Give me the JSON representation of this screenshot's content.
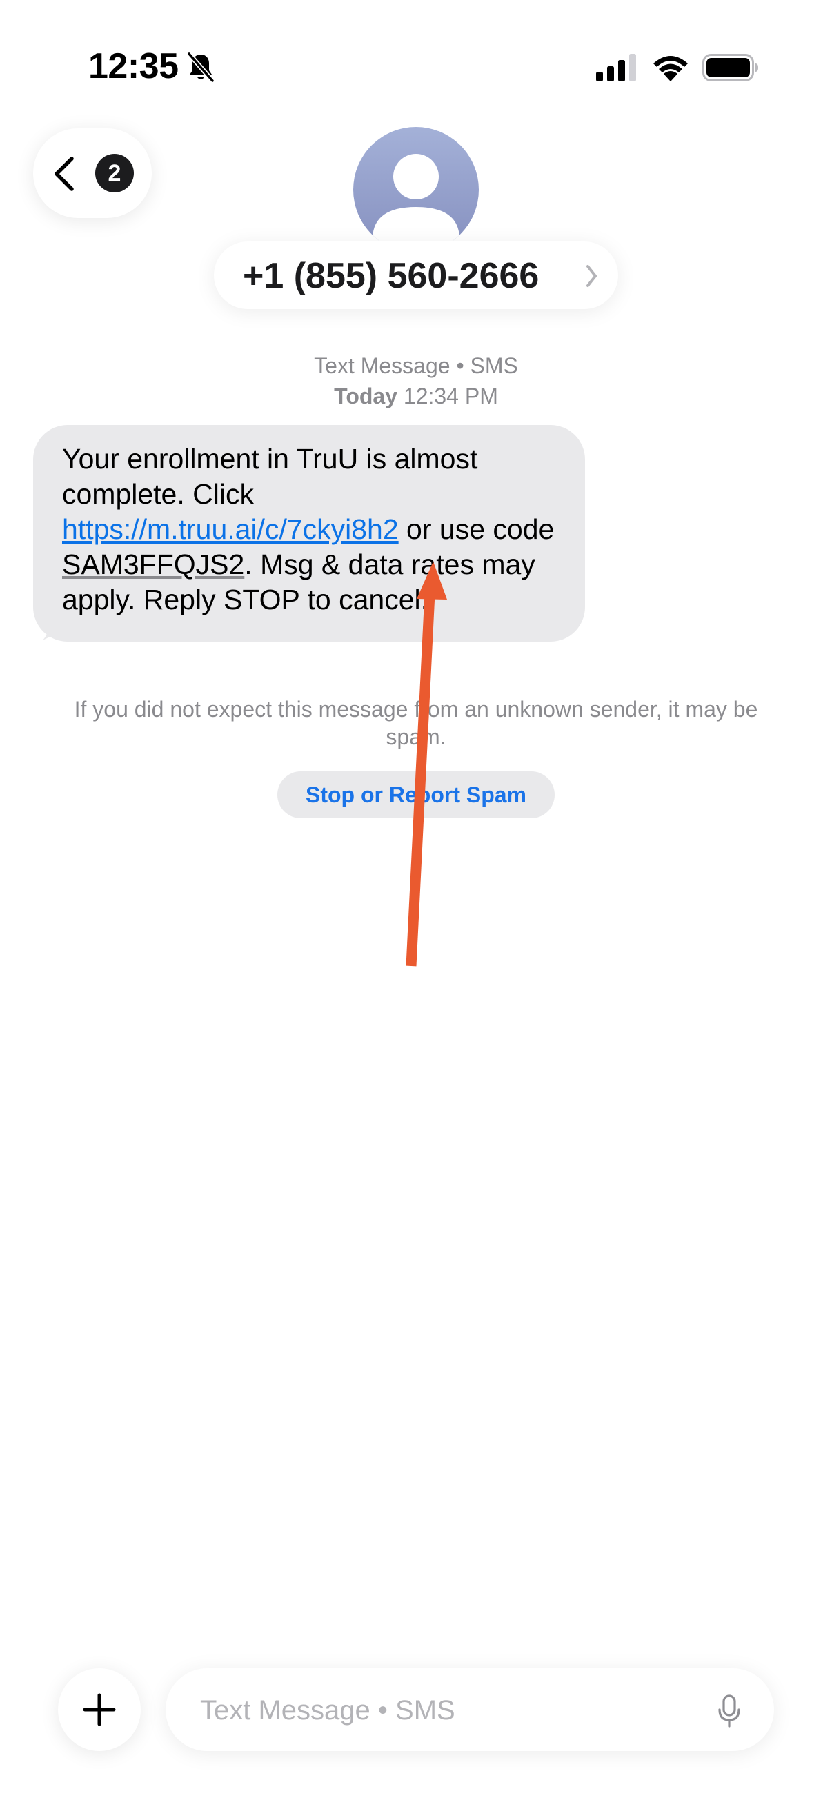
{
  "status_bar": {
    "time": "12:35",
    "icons": [
      "bell-slash-icon",
      "signal-icon",
      "wifi-icon",
      "battery-icon"
    ]
  },
  "header": {
    "back_badge_count": "2",
    "contact": "+1 (855) 560-2666",
    "icons": [
      "chevron-left-icon",
      "person-avatar-icon",
      "chevron-right-icon"
    ]
  },
  "conversation": {
    "meta_service": "Text Message • SMS",
    "meta_day": "Today",
    "meta_time": "12:34 PM",
    "message": {
      "text_before_link": "Your enrollment in TruU is almost complete. Click ",
      "link": "https://m.truu.ai/c/7ckyi8h2",
      "text_before_code": " or use code ",
      "code": "SAM3FFQJS2",
      "text_after_code": ". Msg & data rates may apply. Reply STOP to cancel."
    },
    "spam_notice": "If you did not expect this message from an unknown sender, it may be spam.",
    "spam_button_label": "Stop or Report Spam"
  },
  "composer": {
    "placeholder": "Text Message • SMS",
    "value": "",
    "icons": [
      "plus-icon",
      "microphone-icon"
    ]
  },
  "colors": {
    "link": "#0b72e7",
    "bubble": "#e9e9eb",
    "annotation_arrow": "#ea5a2f",
    "meta_text": "#8a8a8e"
  }
}
